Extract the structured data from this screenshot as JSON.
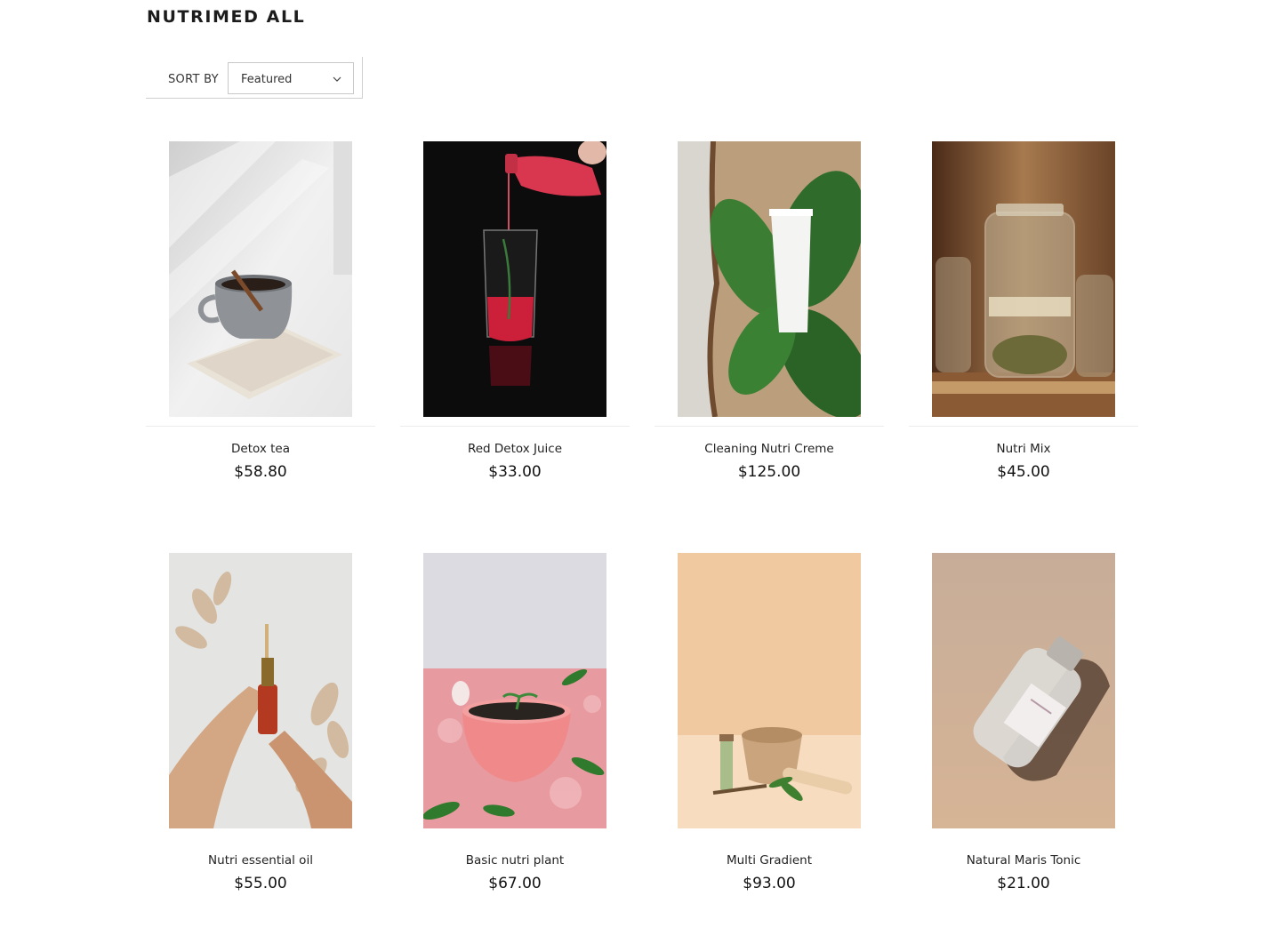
{
  "page": {
    "title": "NUTRIMED ALL"
  },
  "sort": {
    "label": "SORT BY",
    "selected": "Featured"
  },
  "products": [
    {
      "name": "Detox tea",
      "price": "$58.80",
      "image": "tea-cup-image"
    },
    {
      "name": "Red Detox Juice",
      "price": "$33.00",
      "image": "red-juice-image"
    },
    {
      "name": "Cleaning Nutri Creme",
      "price": "$125.00",
      "image": "creme-tube-image"
    },
    {
      "name": "Nutri Mix",
      "price": "$45.00",
      "image": "herb-jars-image"
    },
    {
      "name": "Nutri essential oil",
      "price": "$55.00",
      "image": "oil-dropper-image"
    },
    {
      "name": "Basic nutri plant",
      "price": "$67.00",
      "image": "pink-bowl-plant-image"
    },
    {
      "name": "Multi Gradient",
      "price": "$93.00",
      "image": "mortar-herbs-image"
    },
    {
      "name": "Natural Maris Tonic",
      "price": "$21.00",
      "image": "tonic-bottle-image"
    }
  ]
}
